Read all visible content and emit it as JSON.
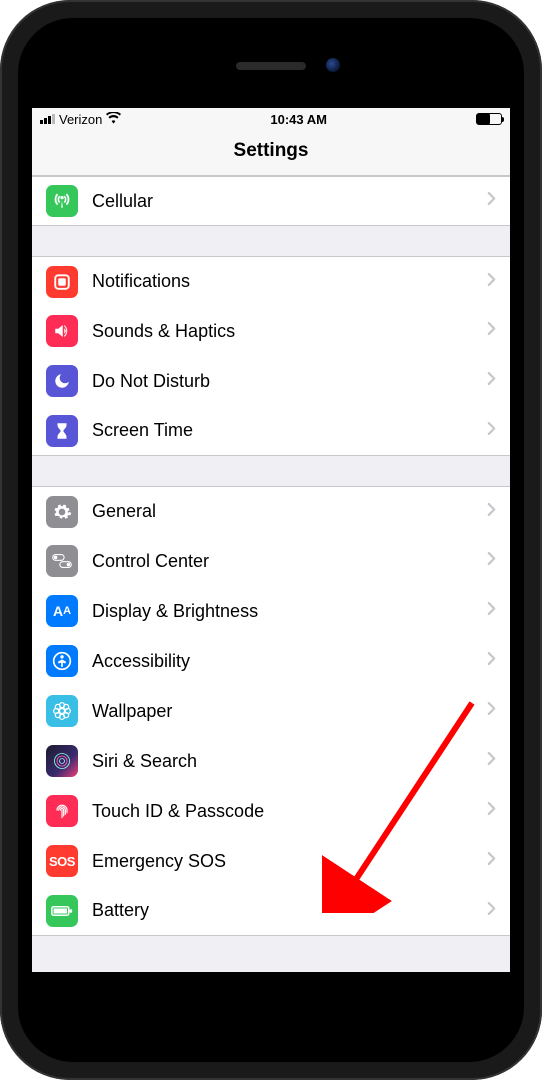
{
  "status_bar": {
    "carrier": "Verizon",
    "time": "10:43 AM"
  },
  "header": {
    "title": "Settings"
  },
  "groups": [
    {
      "rows": [
        {
          "id": "cellular",
          "label": "Cellular",
          "icon_name": "antenna-icon",
          "icon_class": "ic-cellular",
          "svg": "antenna"
        }
      ]
    },
    {
      "rows": [
        {
          "id": "notifications",
          "label": "Notifications",
          "icon_name": "notifications-icon",
          "icon_class": "ic-notif",
          "svg": "square"
        },
        {
          "id": "sounds",
          "label": "Sounds & Haptics",
          "icon_name": "speaker-icon",
          "icon_class": "ic-sounds",
          "svg": "speaker"
        },
        {
          "id": "dnd",
          "label": "Do Not Disturb",
          "icon_name": "moon-icon",
          "icon_class": "ic-dnd",
          "svg": "moon"
        },
        {
          "id": "screentime",
          "label": "Screen Time",
          "icon_name": "hourglass-icon",
          "icon_class": "ic-screentime",
          "svg": "hourglass"
        }
      ]
    },
    {
      "rows": [
        {
          "id": "general",
          "label": "General",
          "icon_name": "gear-icon",
          "icon_class": "ic-general",
          "svg": "gear"
        },
        {
          "id": "control-center",
          "label": "Control Center",
          "icon_name": "toggles-icon",
          "icon_class": "ic-control",
          "svg": "toggles"
        },
        {
          "id": "display",
          "label": "Display & Brightness",
          "icon_name": "text-size-icon",
          "icon_class": "ic-display",
          "svg": "aa"
        },
        {
          "id": "accessibility",
          "label": "Accessibility",
          "icon_name": "accessibility-icon",
          "icon_class": "ic-access",
          "svg": "person"
        },
        {
          "id": "wallpaper",
          "label": "Wallpaper",
          "icon_name": "flower-icon",
          "icon_class": "ic-wallpaper",
          "svg": "flower"
        },
        {
          "id": "siri",
          "label": "Siri & Search",
          "icon_name": "siri-icon",
          "icon_class": "ic-siri",
          "svg": "siri"
        },
        {
          "id": "touchid",
          "label": "Touch ID & Passcode",
          "icon_name": "fingerprint-icon",
          "icon_class": "ic-touchid",
          "svg": "finger"
        },
        {
          "id": "sos",
          "label": "Emergency SOS",
          "icon_name": "sos-icon",
          "icon_class": "ic-sos",
          "svg": "sos"
        },
        {
          "id": "battery",
          "label": "Battery",
          "icon_name": "battery-icon",
          "icon_class": "ic-battery",
          "svg": "battery"
        }
      ]
    }
  ],
  "annotation": {
    "target_row": "touchid",
    "color": "#ff0000"
  }
}
